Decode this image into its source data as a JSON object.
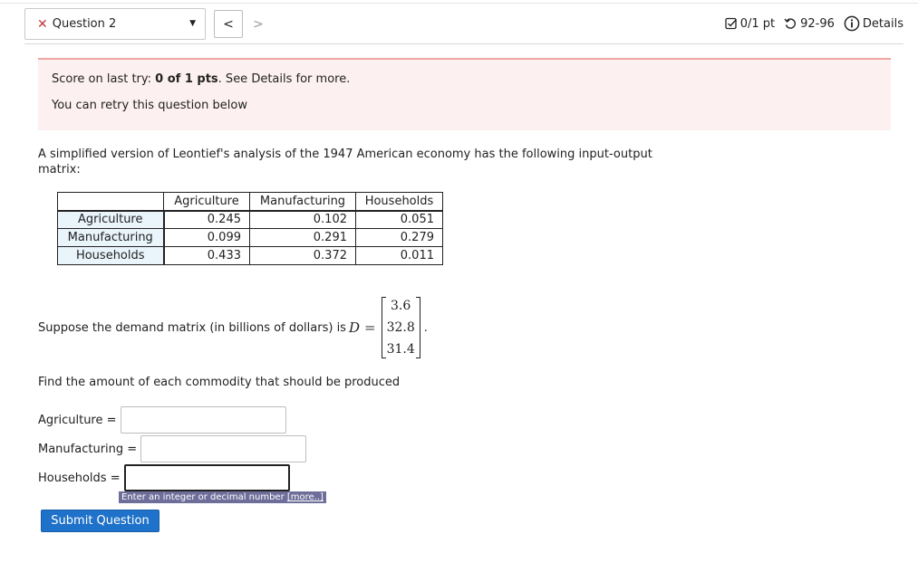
{
  "header": {
    "question_label": "Question 2",
    "score": "0/1 pt",
    "tries": "92-96",
    "details": "Details"
  },
  "alert": {
    "score_prefix": "Score on last try: ",
    "score_value": "0 of 1 pts",
    "score_suffix": ". See Details for more.",
    "retry": "You can retry this question below"
  },
  "problem": {
    "intro": "A simplified version of Leontief's analysis of the 1947 American economy has the following input-output matrix:",
    "table": {
      "columns": [
        "Agriculture",
        "Manufacturing",
        "Households"
      ],
      "rows": [
        {
          "label": "Agriculture",
          "values": [
            "0.245",
            "0.102",
            "0.051"
          ]
        },
        {
          "label": "Manufacturing",
          "values": [
            "0.099",
            "0.291",
            "0.279"
          ]
        },
        {
          "label": "Households",
          "values": [
            "0.433",
            "0.372",
            "0.011"
          ]
        }
      ]
    },
    "demand_text": "Suppose the demand matrix (in billions of dollars) is",
    "demand_symbol": "D",
    "demand_equals": "=",
    "demand_values": [
      "3.6",
      "32.8",
      "31.4"
    ],
    "demand_end": ".",
    "find_text": "Find the amount of each commodity that should be produced"
  },
  "fields": [
    {
      "label": "Agriculture =",
      "value": ""
    },
    {
      "label": "Manufacturing =",
      "value": ""
    },
    {
      "label": "Households =",
      "value": ""
    }
  ],
  "hint": {
    "text": "Enter an integer or decimal number ",
    "more": "[more..]"
  },
  "submit_label": "Submit Question",
  "colors": {
    "accent": "#1f72c9",
    "alert_bg": "#fdf0f0",
    "alert_border": "#f0a5a5",
    "error": "#c4343c",
    "row_header_bg": "#e9f5fb"
  }
}
